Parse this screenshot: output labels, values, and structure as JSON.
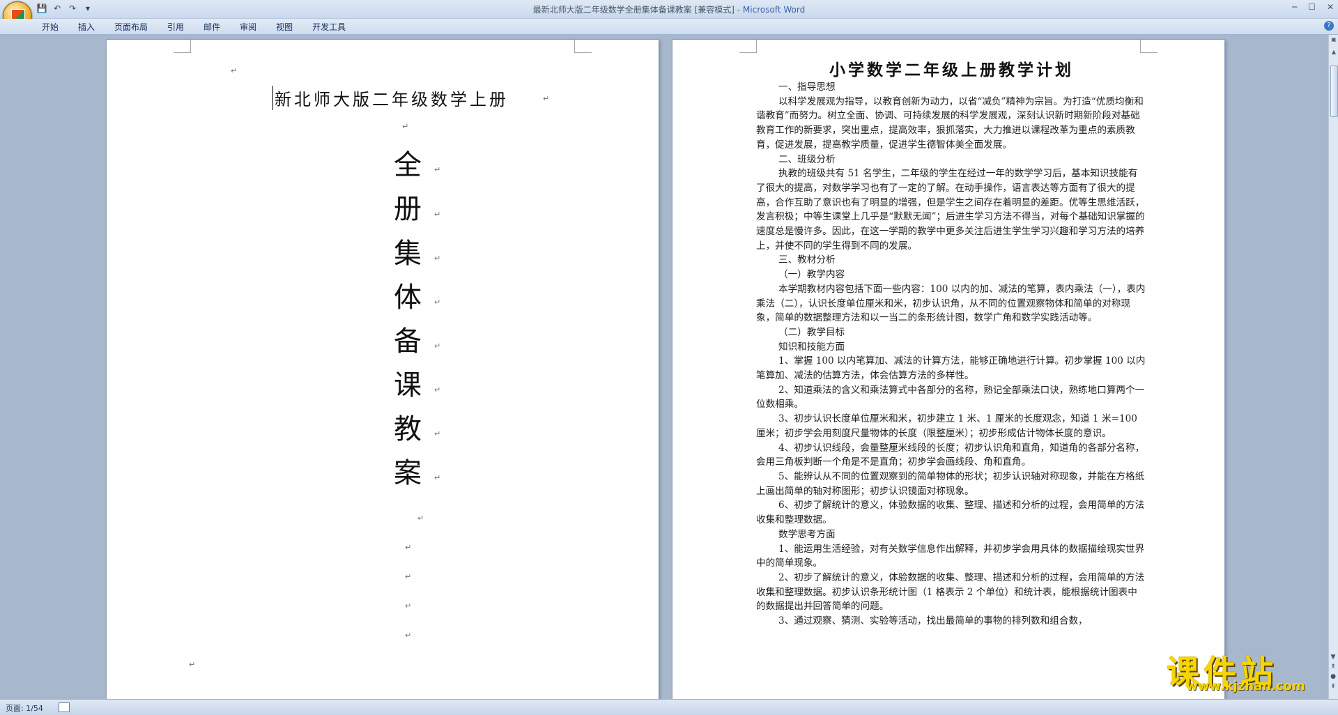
{
  "window": {
    "title_doc": "最新北师大版二年级数学全册集体备课教案 [兼容模式] - ",
    "title_app": "Microsoft Word",
    "controls": [
      "─",
      "☐",
      "✕"
    ]
  },
  "quick_access": {
    "save": "💾",
    "undo": "↶",
    "redo": "↷",
    "customize": "▾"
  },
  "ribbon": {
    "tabs": [
      "开始",
      "插入",
      "页面布局",
      "引用",
      "邮件",
      "审阅",
      "视图",
      "开发工具"
    ],
    "help": "?"
  },
  "status": {
    "page": "页面: 1/54"
  },
  "page1": {
    "title": "新北师大版二年级数学上册",
    "big_chars": [
      "全",
      "册",
      "集",
      "体",
      "备",
      "课",
      "教",
      "案"
    ]
  },
  "page2": {
    "title": "小学数学二年级上册教学计划",
    "lines": [
      {
        "cls": "h",
        "text": "一、指导思想"
      },
      {
        "cls": "ind",
        "text": "以科学发展观为指导，以教育创新为动力，以省“减负”精神为宗旨。为打造“优质均衡和谐教育”而努力。树立全面、协调、可持续发展的科学发展观，深刻认识新时期新阶段对基础教育工作的新要求，突出重点，提高效率，狠抓落实，大力推进以课程改革为重点的素质教育，促进发展，提高教学质量，促进学生德智体美全面发展。"
      },
      {
        "cls": "h",
        "text": "二、班级分析"
      },
      {
        "cls": "ind",
        "text": "执教的班级共有 51 名学生，二年级的学生在经过一年的数学学习后，基本知识技能有了很大的提高，对数学学习也有了一定的了解。在动手操作，语言表达等方面有了很大的提高，合作互助了意识也有了明显的增强，但是学生之间存在着明显的差距。优等生思维活跃，发言积极；中等生课堂上几乎是“默默无闻”；后进生学习方法不得当，对每个基础知识掌握的速度总是慢许多。因此，在这一学期的教学中更多关注后进生学生学习兴趣和学习方法的培养上，并使不同的学生得到不同的发展。"
      },
      {
        "cls": "h",
        "text": "三、教材分析"
      },
      {
        "cls": "h",
        "text": "（一）教学内容"
      },
      {
        "cls": "ind",
        "text": "本学期教材内容包括下面一些内容：100 以内的加、减法的笔算，表内乘法（一），表内乘法（二），认识长度单位厘米和米，初步认识角，从不同的位置观察物体和简单的对称现象，简单的数据整理方法和以一当二的条形统计图，数学广角和数学实践活动等。"
      },
      {
        "cls": "h",
        "text": "（二）教学目标"
      },
      {
        "cls": "h",
        "text": "知识和技能方面"
      },
      {
        "cls": "ind",
        "text": "1、掌握 100 以内笔算加、减法的计算方法，能够正确地进行计算。初步掌握 100 以内笔算加、减法的估算方法，体会估算方法的多样性。"
      },
      {
        "cls": "ind",
        "text": "2、知道乘法的含义和乘法算式中各部分的名称，熟记全部乘法口诀，熟练地口算两个一位数相乘。"
      },
      {
        "cls": "ind",
        "text": "3、初步认识长度单位厘米和米，初步建立 1 米、1 厘米的长度观念，知道 1 米=100 厘米；初步学会用刻度尺量物体的长度（限整厘米）；初步形成估计物体长度的意识。"
      },
      {
        "cls": "ind",
        "text": "4、初步认识线段，会量整厘米线段的长度；初步认识角和直角，知道角的各部分名称，会用三角板判断一个角是不是直角；初步学会画线段、角和直角。"
      },
      {
        "cls": "ind",
        "text": "5、能辨认从不同的位置观察到的简单物体的形状；初步认识轴对称现象，并能在方格纸上画出简单的轴对称图形；初步认识镜面对称现象。"
      },
      {
        "cls": "ind",
        "text": "6、初步了解统计的意义，体验数据的收集、整理、描述和分析的过程，会用简单的方法收集和整理数据。"
      },
      {
        "cls": "h",
        "text": "数学思考方面"
      },
      {
        "cls": "ind",
        "text": "1、能运用生活经验，对有关数学信息作出解释，并初步学会用具体的数据描绘现实世界中的简单现象。"
      },
      {
        "cls": "ind",
        "text": "2、初步了解统计的意义，体验数据的收集、整理、描述和分析的过程，会用简单的方法收集和整理数据。初步认识条形统计图（1 格表示 2 个单位）和统计表，能根据统计图表中的数据提出并回答简单的问题。"
      },
      {
        "cls": "ind",
        "text": "3、通过观察、猜测、实验等活动，找出最简单的事物的排列数和组合数，"
      }
    ]
  },
  "watermark": {
    "name": "课件站",
    "url": "www.kjzhan.com"
  }
}
